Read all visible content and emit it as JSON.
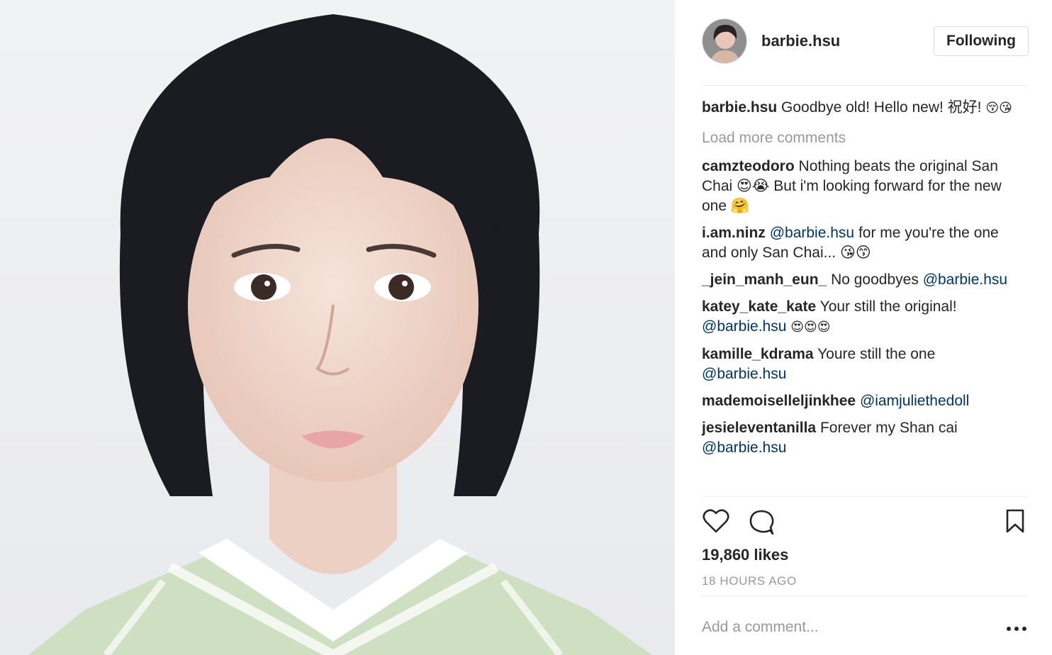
{
  "post": {
    "author": "barbie.hsu",
    "follow_label": "Following",
    "caption": {
      "user": "barbie.hsu",
      "text": "Goodbye old! Hello new! 祝好!",
      "emoji": "😚😘"
    },
    "load_more_label": "Load more comments",
    "comments": [
      {
        "user": "camzteodoro",
        "text": "Nothing beats the original San Chai 😍😭 But i'm looking forward for the new one 🤗",
        "mention": ""
      },
      {
        "user": "i.am.ninz",
        "mention": "@barbie.hsu",
        "text": "for me you're the one and only San Chai... 😘😙"
      },
      {
        "user": "_jein_manh_eun_",
        "text": "No goodbyes",
        "mention": "@barbie.hsu"
      },
      {
        "user": "katey_kate_kate",
        "text": "Your still the original!",
        "mention": "@barbie.hsu",
        "emoji": "😍😍😍"
      },
      {
        "user": "kamille_kdrama",
        "text": "Youre still the one",
        "mention": "@barbie.hsu"
      },
      {
        "user": "mademoiselleljinkhee",
        "mention": "@iamjuliethedoll",
        "text": ""
      },
      {
        "user": "jesieleventanilla",
        "text": "Forever my Shan cai",
        "mention": "@barbie.hsu"
      }
    ],
    "actions": {
      "like_icon": "heart-icon",
      "comment_icon": "speech-bubble-icon",
      "save_icon": "bookmark-icon"
    },
    "likes_label": "19,860 likes",
    "timestamp": "18 HOURS AGO",
    "add_comment_placeholder": "Add a comment...",
    "more_icon": "ellipsis-icon"
  },
  "colors": {
    "text": "#262626",
    "muted": "#999999",
    "mention": "#003569",
    "border": "#dbdbdb"
  }
}
